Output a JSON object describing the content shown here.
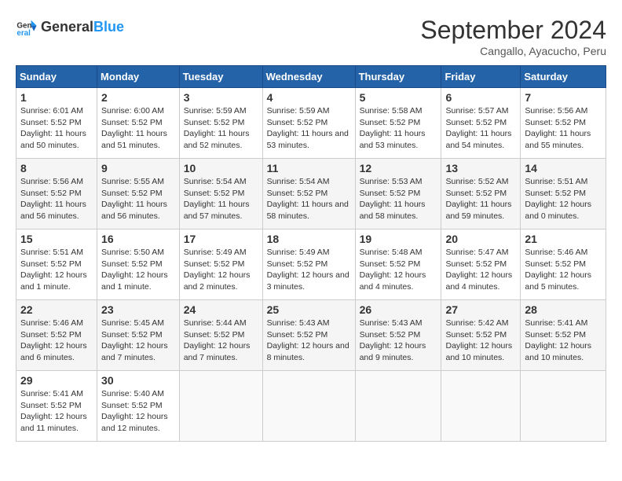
{
  "header": {
    "logo": {
      "general": "General",
      "blue": "Blue"
    },
    "title": "September 2024",
    "location": "Cangallo, Ayacucho, Peru"
  },
  "days_of_week": [
    "Sunday",
    "Monday",
    "Tuesday",
    "Wednesday",
    "Thursday",
    "Friday",
    "Saturday"
  ],
  "weeks": [
    [
      {
        "day": "1",
        "sunrise": "6:01 AM",
        "sunset": "5:52 PM",
        "daylight": "11 hours and 50 minutes."
      },
      {
        "day": "2",
        "sunrise": "6:00 AM",
        "sunset": "5:52 PM",
        "daylight": "11 hours and 51 minutes."
      },
      {
        "day": "3",
        "sunrise": "5:59 AM",
        "sunset": "5:52 PM",
        "daylight": "11 hours and 52 minutes."
      },
      {
        "day": "4",
        "sunrise": "5:59 AM",
        "sunset": "5:52 PM",
        "daylight": "11 hours and 53 minutes."
      },
      {
        "day": "5",
        "sunrise": "5:58 AM",
        "sunset": "5:52 PM",
        "daylight": "11 hours and 53 minutes."
      },
      {
        "day": "6",
        "sunrise": "5:57 AM",
        "sunset": "5:52 PM",
        "daylight": "11 hours and 54 minutes."
      },
      {
        "day": "7",
        "sunrise": "5:56 AM",
        "sunset": "5:52 PM",
        "daylight": "11 hours and 55 minutes."
      }
    ],
    [
      {
        "day": "8",
        "sunrise": "5:56 AM",
        "sunset": "5:52 PM",
        "daylight": "11 hours and 56 minutes."
      },
      {
        "day": "9",
        "sunrise": "5:55 AM",
        "sunset": "5:52 PM",
        "daylight": "11 hours and 56 minutes."
      },
      {
        "day": "10",
        "sunrise": "5:54 AM",
        "sunset": "5:52 PM",
        "daylight": "11 hours and 57 minutes."
      },
      {
        "day": "11",
        "sunrise": "5:54 AM",
        "sunset": "5:52 PM",
        "daylight": "11 hours and 58 minutes."
      },
      {
        "day": "12",
        "sunrise": "5:53 AM",
        "sunset": "5:52 PM",
        "daylight": "11 hours and 58 minutes."
      },
      {
        "day": "13",
        "sunrise": "5:52 AM",
        "sunset": "5:52 PM",
        "daylight": "11 hours and 59 minutes."
      },
      {
        "day": "14",
        "sunrise": "5:51 AM",
        "sunset": "5:52 PM",
        "daylight": "12 hours and 0 minutes."
      }
    ],
    [
      {
        "day": "15",
        "sunrise": "5:51 AM",
        "sunset": "5:52 PM",
        "daylight": "12 hours and 1 minute."
      },
      {
        "day": "16",
        "sunrise": "5:50 AM",
        "sunset": "5:52 PM",
        "daylight": "12 hours and 1 minute."
      },
      {
        "day": "17",
        "sunrise": "5:49 AM",
        "sunset": "5:52 PM",
        "daylight": "12 hours and 2 minutes."
      },
      {
        "day": "18",
        "sunrise": "5:49 AM",
        "sunset": "5:52 PM",
        "daylight": "12 hours and 3 minutes."
      },
      {
        "day": "19",
        "sunrise": "5:48 AM",
        "sunset": "5:52 PM",
        "daylight": "12 hours and 4 minutes."
      },
      {
        "day": "20",
        "sunrise": "5:47 AM",
        "sunset": "5:52 PM",
        "daylight": "12 hours and 4 minutes."
      },
      {
        "day": "21",
        "sunrise": "5:46 AM",
        "sunset": "5:52 PM",
        "daylight": "12 hours and 5 minutes."
      }
    ],
    [
      {
        "day": "22",
        "sunrise": "5:46 AM",
        "sunset": "5:52 PM",
        "daylight": "12 hours and 6 minutes."
      },
      {
        "day": "23",
        "sunrise": "5:45 AM",
        "sunset": "5:52 PM",
        "daylight": "12 hours and 7 minutes."
      },
      {
        "day": "24",
        "sunrise": "5:44 AM",
        "sunset": "5:52 PM",
        "daylight": "12 hours and 7 minutes."
      },
      {
        "day": "25",
        "sunrise": "5:43 AM",
        "sunset": "5:52 PM",
        "daylight": "12 hours and 8 minutes."
      },
      {
        "day": "26",
        "sunrise": "5:43 AM",
        "sunset": "5:52 PM",
        "daylight": "12 hours and 9 minutes."
      },
      {
        "day": "27",
        "sunrise": "5:42 AM",
        "sunset": "5:52 PM",
        "daylight": "12 hours and 10 minutes."
      },
      {
        "day": "28",
        "sunrise": "5:41 AM",
        "sunset": "5:52 PM",
        "daylight": "12 hours and 10 minutes."
      }
    ],
    [
      {
        "day": "29",
        "sunrise": "5:41 AM",
        "sunset": "5:52 PM",
        "daylight": "12 hours and 11 minutes."
      },
      {
        "day": "30",
        "sunrise": "5:40 AM",
        "sunset": "5:52 PM",
        "daylight": "12 hours and 12 minutes."
      },
      null,
      null,
      null,
      null,
      null
    ]
  ]
}
